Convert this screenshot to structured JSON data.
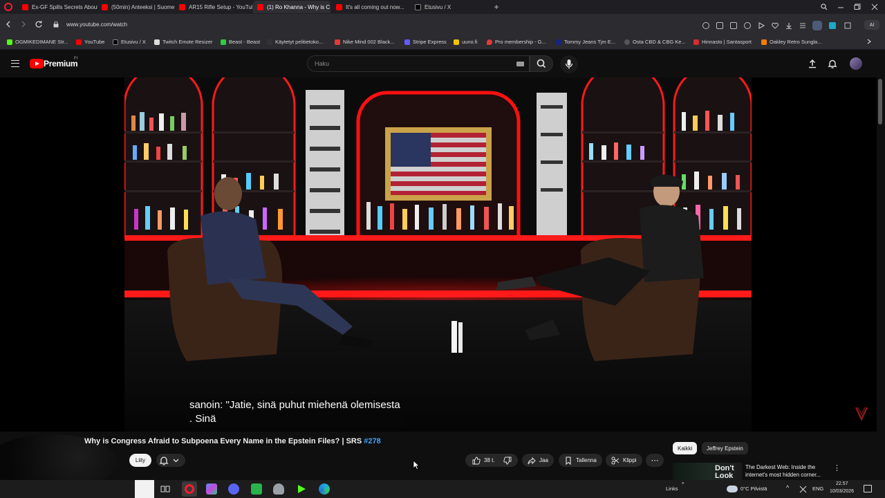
{
  "browser": {
    "tabs": [
      {
        "label": "Ex-GF Spills Secrets About",
        "favicon_color": "#ff0000",
        "active": false
      },
      {
        "label": "(50min) Anteeksi | Suome",
        "favicon_color": "#ff0000",
        "active": false
      },
      {
        "label": "AR15 Rifle Setup - YouTub",
        "favicon_color": "#ff0000",
        "active": false
      },
      {
        "label": "(1) Ro Khanna - Why is C",
        "favicon_color": "#ff0000",
        "active": true
      },
      {
        "label": "It's all coming out now...",
        "favicon_color": "#ff0000",
        "active": false
      },
      {
        "label": "Etusivu / X",
        "favicon_color": "#000000",
        "active": false
      }
    ],
    "new_tab_symbol": "+",
    "url": "www.youtube.com/watch",
    "bookmarks": [
      {
        "label": "OGMIKEDIMANE Str...",
        "color": "#53fc18"
      },
      {
        "label": "YouTube",
        "color": "#ff0000"
      },
      {
        "label": "Etusivu / X",
        "color": "#000000"
      },
      {
        "label": "Twitch Emote Resizer",
        "color": "#dcdcdc"
      },
      {
        "label": "Beast - Beast",
        "color": "#2ecc40"
      },
      {
        "label": "Käytetyt pelitietoko...",
        "color": "#333333"
      },
      {
        "label": "Nike Mind 002 Black...",
        "color": "#e53935"
      },
      {
        "label": "Stripe Express",
        "color": "#635bff"
      },
      {
        "label": "uuno.fi",
        "color": "#f2c300"
      },
      {
        "label": "Pro membership - G...",
        "color": "#e53935"
      },
      {
        "label": "Tommy Jeans Tjm E...",
        "color": "#1a237e"
      },
      {
        "label": "Osta CBD & CBG Ke...",
        "color": "#555555"
      },
      {
        "label": "Hinnasto | Santasport",
        "color": "#d32f2f"
      },
      {
        "label": "Oakley Retro Sungla...",
        "color": "#f57c00"
      }
    ]
  },
  "youtube": {
    "brand": "Premium",
    "country_code": "FI",
    "search_placeholder": "Haku"
  },
  "video": {
    "caption_line1": "sanoin: \"Jatie, sinä puhut miehenä olemisesta",
    "caption_line2": ". Sinä",
    "title_text": "Why is Congress Afraid to Subpoena Every Name in the Epstein Files? | SRS ",
    "title_tag": "#278",
    "join_label": "Liity",
    "like_count": "38 t.",
    "share_label": "Jaa",
    "save_label": "Tallenna",
    "clip_label": "Klippi",
    "more_symbol": "⋯"
  },
  "recommendations": {
    "chips": [
      "Kaikki",
      "Jeffrey Epstein"
    ],
    "first_title": "The Darkest Web: Inside the internet's most hidden corner...",
    "first_thumb_text": "Don't Look"
  },
  "taskbar": {
    "links_label": "Links",
    "weather": "0°C Pilvistä",
    "language": "ENG",
    "time": "22.57",
    "date": "10/03/2026"
  }
}
